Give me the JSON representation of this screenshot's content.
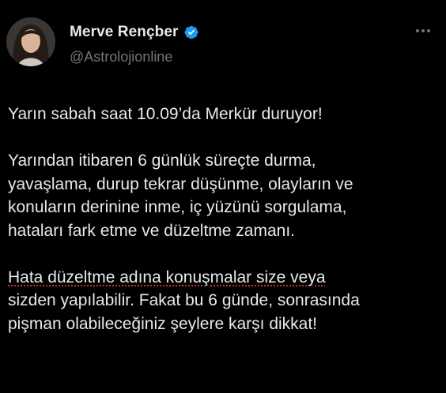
{
  "author": {
    "display_name": "Merve Rençber",
    "handle": "@Astrolojionline",
    "verified_icon": "verified-badge-icon",
    "avatar_icon": "avatar-photo"
  },
  "menu": {
    "icon": "more-horizontal-icon"
  },
  "tweet": {
    "paragraphs": [
      {
        "lines": [
          "Yarın sabah saat 10.09’da Merkür duruyor!"
        ]
      },
      {
        "lines": [
          "Yarından itibaren 6 günlük süreçte durma,",
          "yavaşlama, durup tekrar düşünme, olayların ve",
          "konuların derinine inme, iç yüzünü sorgulama,",
          "hataları fark etme ve düzeltme zamanı."
        ]
      },
      {
        "lines": [
          "Hata düzeltme adına konuşmalar size veya",
          "sizden yapılabilir. Fakat bu 6 günde, sonrasında",
          "pişman olabileceğiniz şeylere karşı dikkat!"
        ]
      }
    ]
  },
  "colors": {
    "background": "#000000",
    "text": "#e7e9ea",
    "secondary": "#71767b",
    "verified": "#1d9bf0"
  }
}
